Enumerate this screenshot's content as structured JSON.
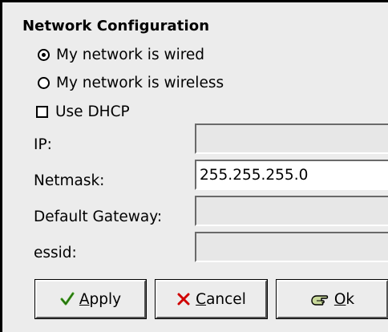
{
  "dialog": {
    "title": "Network Configuration"
  },
  "connection_type": {
    "wired_label": "My network is wired",
    "wireless_label": "My network is wireless",
    "selected": "wired"
  },
  "dhcp": {
    "label": "Use DHCP",
    "checked": false
  },
  "fields": {
    "ip": {
      "label": "IP:",
      "value": ""
    },
    "netmask": {
      "label": "Netmask:",
      "value": "255.255.255.0"
    },
    "gateway": {
      "label": "Default Gateway:",
      "value": ""
    },
    "essid": {
      "label": "essid:",
      "value": ""
    }
  },
  "buttons": {
    "apply": {
      "mnemonic": "A",
      "rest": "pply",
      "icon": "checkmark-icon"
    },
    "cancel": {
      "mnemonic": "C",
      "rest": "ancel",
      "icon": "x-icon"
    },
    "ok": {
      "mnemonic": "O",
      "rest": "k",
      "icon": "pointing-hand-icon"
    }
  },
  "colors": {
    "background": "#ececec",
    "check_green": "#3f9d1f",
    "cancel_red": "#d00000",
    "hand_green": "#7a9a3a"
  }
}
